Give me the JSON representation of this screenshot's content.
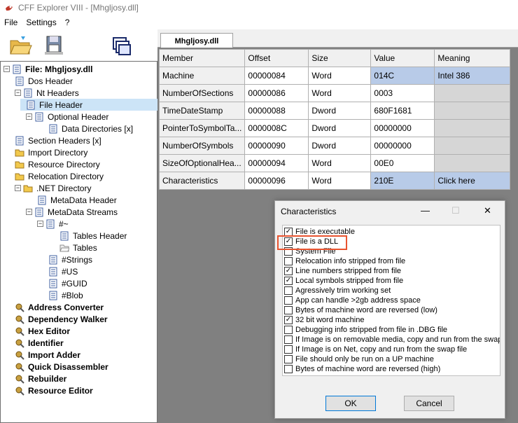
{
  "window": {
    "title": "CFF Explorer VIII - [Mhgljosy.dll]"
  },
  "menu": [
    "File",
    "Settings",
    "?"
  ],
  "tab": {
    "label": "Mhgljosy.dll"
  },
  "grid": {
    "headers": [
      "Member",
      "Offset",
      "Size",
      "Value",
      "Meaning"
    ],
    "rows": [
      {
        "member": "Machine",
        "offset": "00000084",
        "size": "Word",
        "value": "014C",
        "meaning": "Intel 386"
      },
      {
        "member": "NumberOfSections",
        "offset": "00000086",
        "size": "Word",
        "value": "0003",
        "meaning": ""
      },
      {
        "member": "TimeDateStamp",
        "offset": "00000088",
        "size": "Dword",
        "value": "680F1681",
        "meaning": ""
      },
      {
        "member": "PointerToSymbolTa...",
        "offset": "0000008C",
        "size": "Dword",
        "value": "00000000",
        "meaning": ""
      },
      {
        "member": "NumberOfSymbols",
        "offset": "00000090",
        "size": "Dword",
        "value": "00000000",
        "meaning": ""
      },
      {
        "member": "SizeOfOptionalHea...",
        "offset": "00000094",
        "size": "Word",
        "value": "00E0",
        "meaning": ""
      },
      {
        "member": "Characteristics",
        "offset": "00000096",
        "size": "Word",
        "value": "210E",
        "meaning": "Click here"
      }
    ]
  },
  "tree": [
    {
      "label": "File: Mhgljosy.dll",
      "bold": true
    },
    {
      "label": "Dos Header"
    },
    {
      "label": "Nt Headers"
    },
    {
      "label": "File Header"
    },
    {
      "label": "Optional Header"
    },
    {
      "label": "Data Directories [x]"
    },
    {
      "label": "Section Headers [x]"
    },
    {
      "label": "Import Directory"
    },
    {
      "label": "Resource Directory"
    },
    {
      "label": "Relocation Directory"
    },
    {
      "label": ".NET Directory"
    },
    {
      "label": "MetaData Header"
    },
    {
      "label": "MetaData Streams"
    },
    {
      "label": "#~"
    },
    {
      "label": "Tables Header"
    },
    {
      "label": "Tables"
    },
    {
      "label": "#Strings"
    },
    {
      "label": "#US"
    },
    {
      "label": "#GUID"
    },
    {
      "label": "#Blob"
    },
    {
      "label": "Address Converter",
      "bold": true
    },
    {
      "label": "Dependency Walker",
      "bold": true
    },
    {
      "label": "Hex Editor",
      "bold": true
    },
    {
      "label": "Identifier",
      "bold": true
    },
    {
      "label": "Import Adder",
      "bold": true
    },
    {
      "label": "Quick Disassembler",
      "bold": true
    },
    {
      "label": "Rebuilder",
      "bold": true
    },
    {
      "label": "Resource Editor",
      "bold": true
    }
  ],
  "dialog": {
    "title": "Characteristics",
    "ok_label": "OK",
    "cancel_label": "Cancel",
    "flags": [
      {
        "label": "File is executable",
        "checked": true
      },
      {
        "label": "File is a DLL",
        "checked": true
      },
      {
        "label": "System File",
        "checked": false
      },
      {
        "label": "Relocation info stripped from file",
        "checked": false
      },
      {
        "label": "Line numbers stripped from file",
        "checked": true
      },
      {
        "label": "Local symbols stripped from file",
        "checked": true
      },
      {
        "label": "Agressively trim working set",
        "checked": false
      },
      {
        "label": "App can handle >2gb address space",
        "checked": false
      },
      {
        "label": "Bytes of machine word are reversed (low)",
        "checked": false
      },
      {
        "label": "32 bit word machine",
        "checked": true
      },
      {
        "label": "Debugging info stripped from file in .DBG file",
        "checked": false
      },
      {
        "label": "If Image is on removable media, copy and run from the swap",
        "checked": false
      },
      {
        "label": "If Image is on Net, copy and run from the swap file",
        "checked": false
      },
      {
        "label": "File should only be run on a UP machine",
        "checked": false
      },
      {
        "label": "Bytes of machine word are reversed (high)",
        "checked": false
      }
    ]
  }
}
